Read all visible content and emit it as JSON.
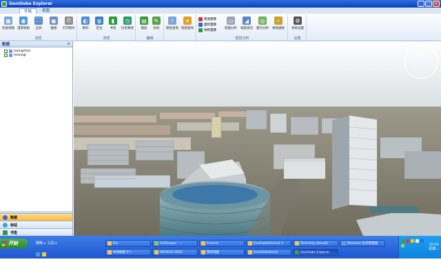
{
  "window": {
    "title": "GeoGlobe Explorer"
  },
  "ribbon": {
    "tabs": [
      "开始",
      "视图"
    ],
    "groups": [
      {
        "name": "浏览",
        "tools": [
          "恢复视图",
          "漫游视角",
          "全屏",
          "截图",
          "打印图片"
        ]
      },
      {
        "name": "浏览",
        "tools": [
          "俯仰",
          "定位",
          "书签",
          "历史路径"
        ]
      },
      {
        "name": "编辑",
        "tools": [
          "图层",
          "标绘"
        ]
      },
      {
        "name": "",
        "tools": [
          "属性查询",
          "链接查询"
        ]
      },
      {
        "name": "视觉分析",
        "tools": [
          "剖面分析",
          "坡度坡向",
          "量点分析",
          "视线通视"
        ],
        "small_tools": [
          "距离量算",
          "面积量算",
          "体积量算"
        ]
      },
      {
        "name": "设置",
        "tools": [
          "系统设置"
        ]
      }
    ]
  },
  "left_panel": {
    "title": "数据",
    "tree": [
      "laxingshon",
      "mosingl"
    ],
    "nav": [
      "数据",
      "标站",
      "书签"
    ]
  },
  "taskbar": {
    "start": "开始",
    "quick": [
      "网络",
      "工具"
    ],
    "row1": [
      "Dis",
      "GetZoopor - ...",
      "Exlonoc",
      "GeoGlobeVision2.1",
      "SketchUp_Result2",
      "Windows 任务管理器"
    ],
    "row2": [
      "本地磁盘 (F:)",
      "DEOIO(E:/SZS)",
      "我的电脑",
      "GeoGlobeVision",
      "GeoGlobe Explorer"
    ],
    "clock_time": "10:42",
    "clock_day": "星期..."
  },
  "colors": {
    "titlebar": "#0a3fb8",
    "taskbar": "#1f57cf",
    "nav_active": "#f7b845"
  }
}
